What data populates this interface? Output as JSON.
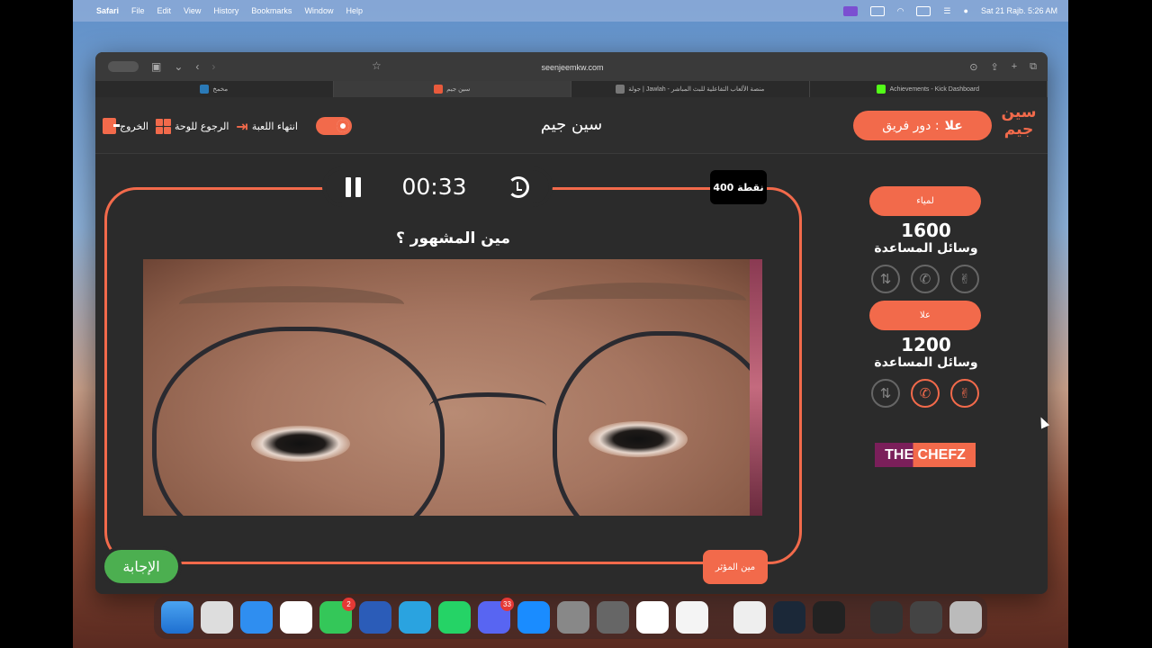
{
  "menubar": {
    "app": "Safari",
    "items": [
      "File",
      "Edit",
      "View",
      "History",
      "Bookmarks",
      "Window",
      "Help"
    ],
    "datetime": "Sat 21 Rajb.  5:26 AM"
  },
  "browser": {
    "url": "seenjeemkw.com",
    "tabs": [
      {
        "label": "مخمخ",
        "color": "#2a7ab8"
      },
      {
        "label": "سين جيم",
        "color": "#e85a3c",
        "active": true
      },
      {
        "label": "جولة | Jawlah - منصة الألعاب التفاعلية للبث المباشر",
        "color": "#777"
      },
      {
        "label": "Achievements - Kick Dashboard",
        "color": "#53fc18"
      }
    ]
  },
  "app": {
    "logo": "سين جيم",
    "turn_label": "دور فريق :",
    "turn_team": "علا",
    "title": "سين جيم",
    "end_game": "انتهاء اللعبة",
    "back_to_board": "الرجوع للوحة",
    "exit": "الخروج",
    "timer": "00:33",
    "points": "400 نقطة",
    "question": "مين المشهور ؟",
    "answer_button": "الإجابة",
    "category_tag": "مين المؤثر",
    "aids_label": "وسائل المساعدة",
    "teams": [
      {
        "name": "لمياء",
        "score": "1600"
      },
      {
        "name": "علا",
        "score": "1200"
      }
    ],
    "sponsor": "THE CHEFZ",
    "accent": "#f26a4b"
  },
  "dock": {
    "badges": {
      "facetime": "2",
      "discord": "33"
    }
  }
}
